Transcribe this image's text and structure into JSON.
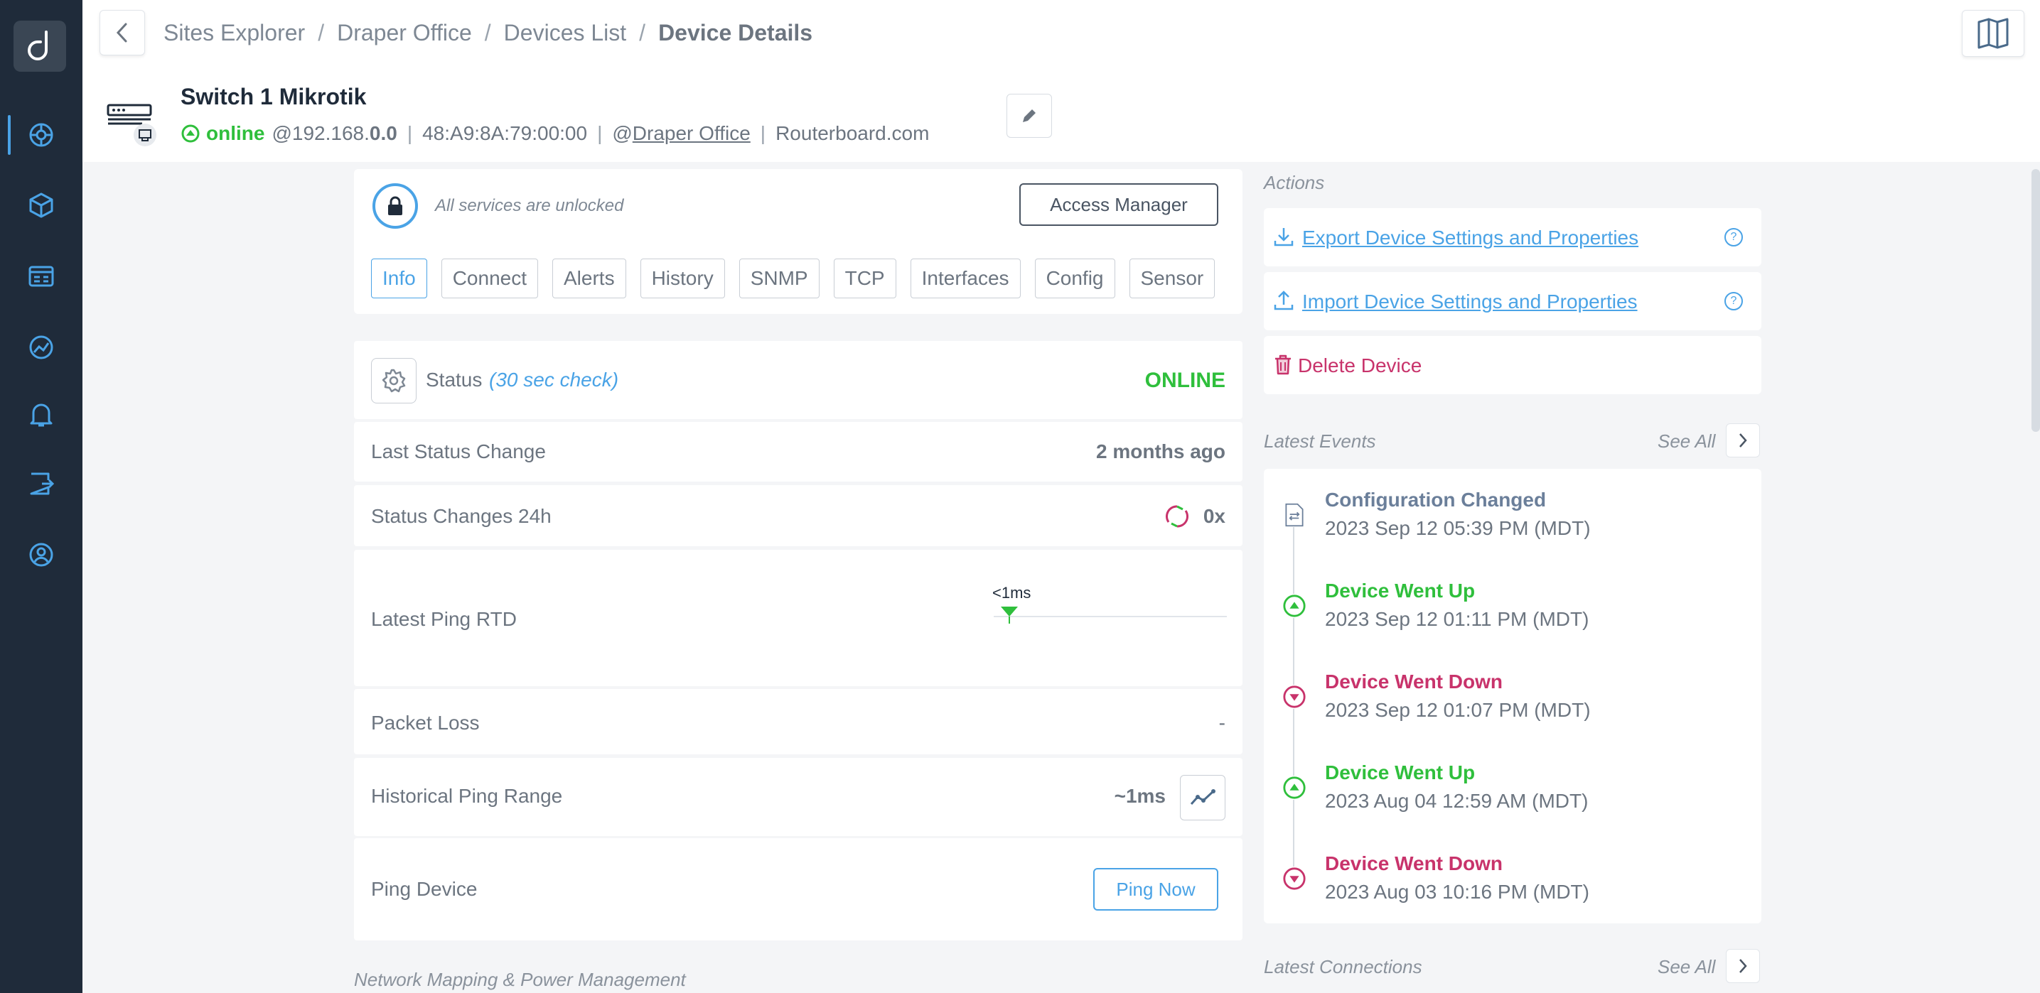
{
  "breadcrumb": {
    "items": [
      "Sites Explorer",
      "Draper Office",
      "Devices List"
    ],
    "current": "Device Details",
    "separator": "/"
  },
  "device": {
    "name": "Switch 1 Mikrotik",
    "status": "online",
    "ip_prefix": "@192.168.",
    "ip_bold": "0.0",
    "mac": "48:A9:8A:79:00:00",
    "site_prefix": "@",
    "site": "Draper Office",
    "vendor": "Routerboard.com"
  },
  "lock": {
    "text": "All services are unlocked",
    "access_button": "Access Manager"
  },
  "tabs": [
    "Info",
    "Connect",
    "Alerts",
    "History",
    "SNMP",
    "TCP",
    "Interfaces",
    "Config",
    "Sensor"
  ],
  "status": {
    "label": "Status",
    "check": "(30 sec check)",
    "value": "ONLINE"
  },
  "rows": {
    "last_status_change": {
      "label": "Last Status Change",
      "value": "2 months ago"
    },
    "status_changes": {
      "label": "Status Changes 24h",
      "value": "0x"
    },
    "latest_ping": {
      "label": "Latest Ping RTD",
      "marker": "<1ms"
    },
    "packet_loss": {
      "label": "Packet Loss",
      "value": "-"
    },
    "historical_ping": {
      "label": "Historical Ping Range",
      "value": "~1ms"
    },
    "ping_device": {
      "label": "Ping Device",
      "button": "Ping Now"
    }
  },
  "network_mapping_label": "Network Mapping & Power Management",
  "actions": {
    "label": "Actions",
    "export": "Export Device Settings and Properties",
    "import": "Import Device Settings and Properties",
    "delete": "Delete Device",
    "help": "?"
  },
  "events": {
    "label": "Latest Events",
    "see_all": "See All",
    "items": [
      {
        "title": "Configuration Changed",
        "date": "2023 Sep 12 05:39 PM (MDT)",
        "type": "config"
      },
      {
        "title": "Device Went Up",
        "date": "2023 Sep 12 01:11 PM (MDT)",
        "type": "up"
      },
      {
        "title": "Device Went Down",
        "date": "2023 Sep 12 01:07 PM (MDT)",
        "type": "down"
      },
      {
        "title": "Device Went Up",
        "date": "2023 Aug 04 12:59 AM (MDT)",
        "type": "up"
      },
      {
        "title": "Device Went Down",
        "date": "2023 Aug 03 10:16 PM (MDT)",
        "type": "down"
      }
    ]
  },
  "connections": {
    "label": "Latest Connections",
    "see_all": "See All"
  },
  "colors": {
    "sidebar": "#1f2b3a",
    "accent": "#4aa3e6",
    "online": "#2fbf3c",
    "down": "#c8336b",
    "config": "#6b7f9a"
  }
}
